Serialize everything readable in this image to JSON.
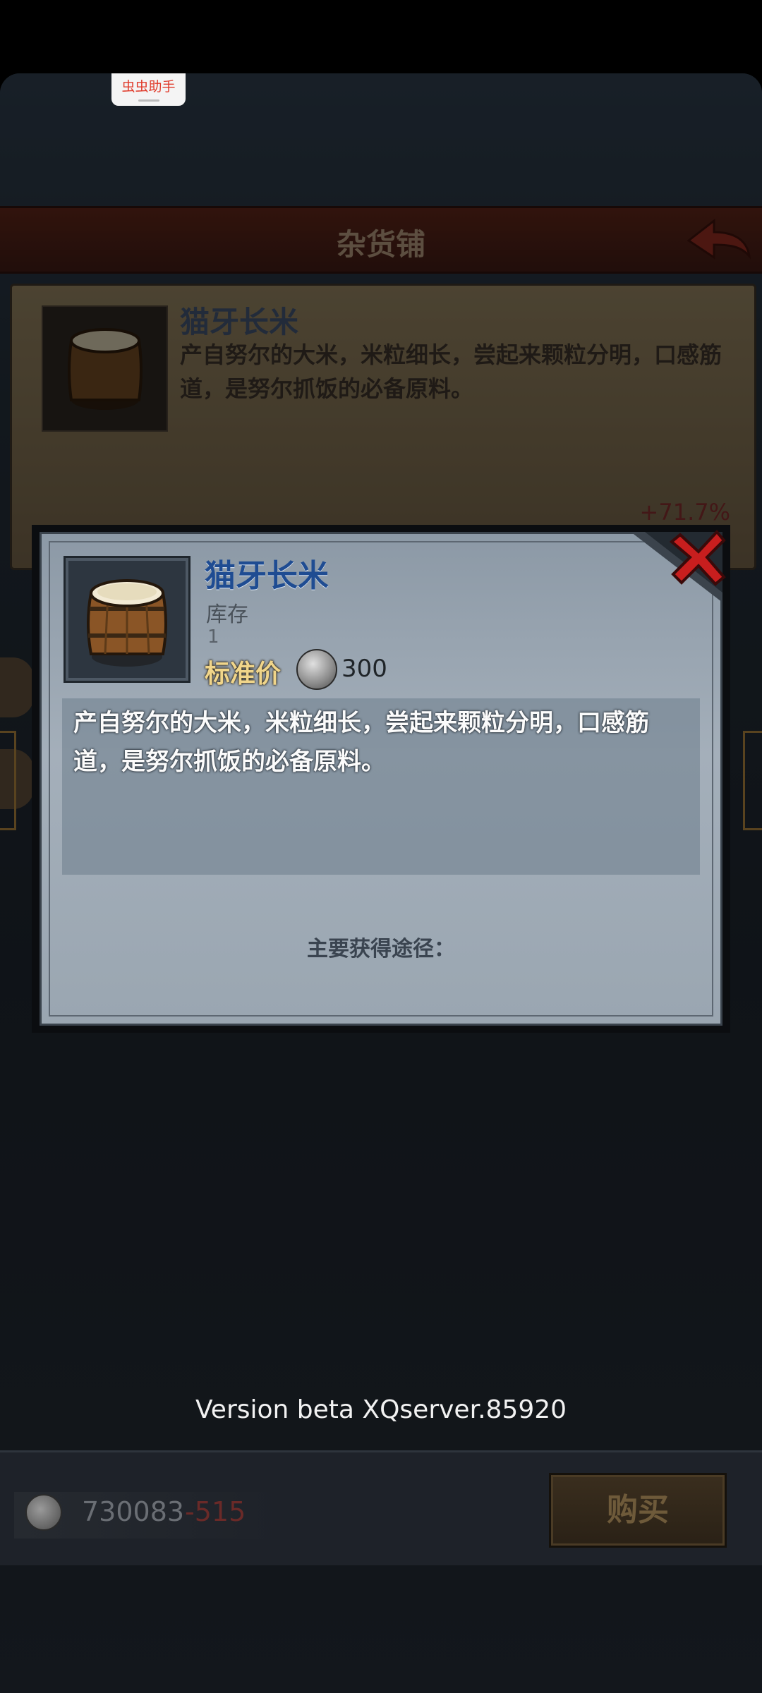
{
  "helper_badge": {
    "label": "虫虫助手"
  },
  "shop": {
    "title": "杂货铺",
    "back_icon": "back-arrow-icon"
  },
  "background_panel": {
    "item_name": "猫牙长米",
    "description": "产自努尔的大米，米粒细长，尝起来颗粒分明，口感筋道，是努尔抓饭的必备原料。",
    "price_change": "+71.7%"
  },
  "modal": {
    "item_name": "猫牙长米",
    "stock_label": "库存",
    "stock_value": "1",
    "price_label": "标准价",
    "price_value": "300",
    "description": "产自努尔的大米，米粒细长，尝起来颗粒分明，口感筋道，是努尔抓饭的必备原料。",
    "source_label": "主要获得途径：",
    "icons": {
      "item": "rice-barrel-icon",
      "currency": "silver-coin-icon",
      "close": "close-x-icon"
    }
  },
  "version": "Version beta XQserver.85920",
  "bottom_bar": {
    "money": "730083",
    "money_diff": "-515",
    "buy_label": "购买"
  },
  "colors": {
    "item_name": "#1f4c92",
    "price_label": "#f0d58a",
    "close_red": "#c81e1e"
  }
}
